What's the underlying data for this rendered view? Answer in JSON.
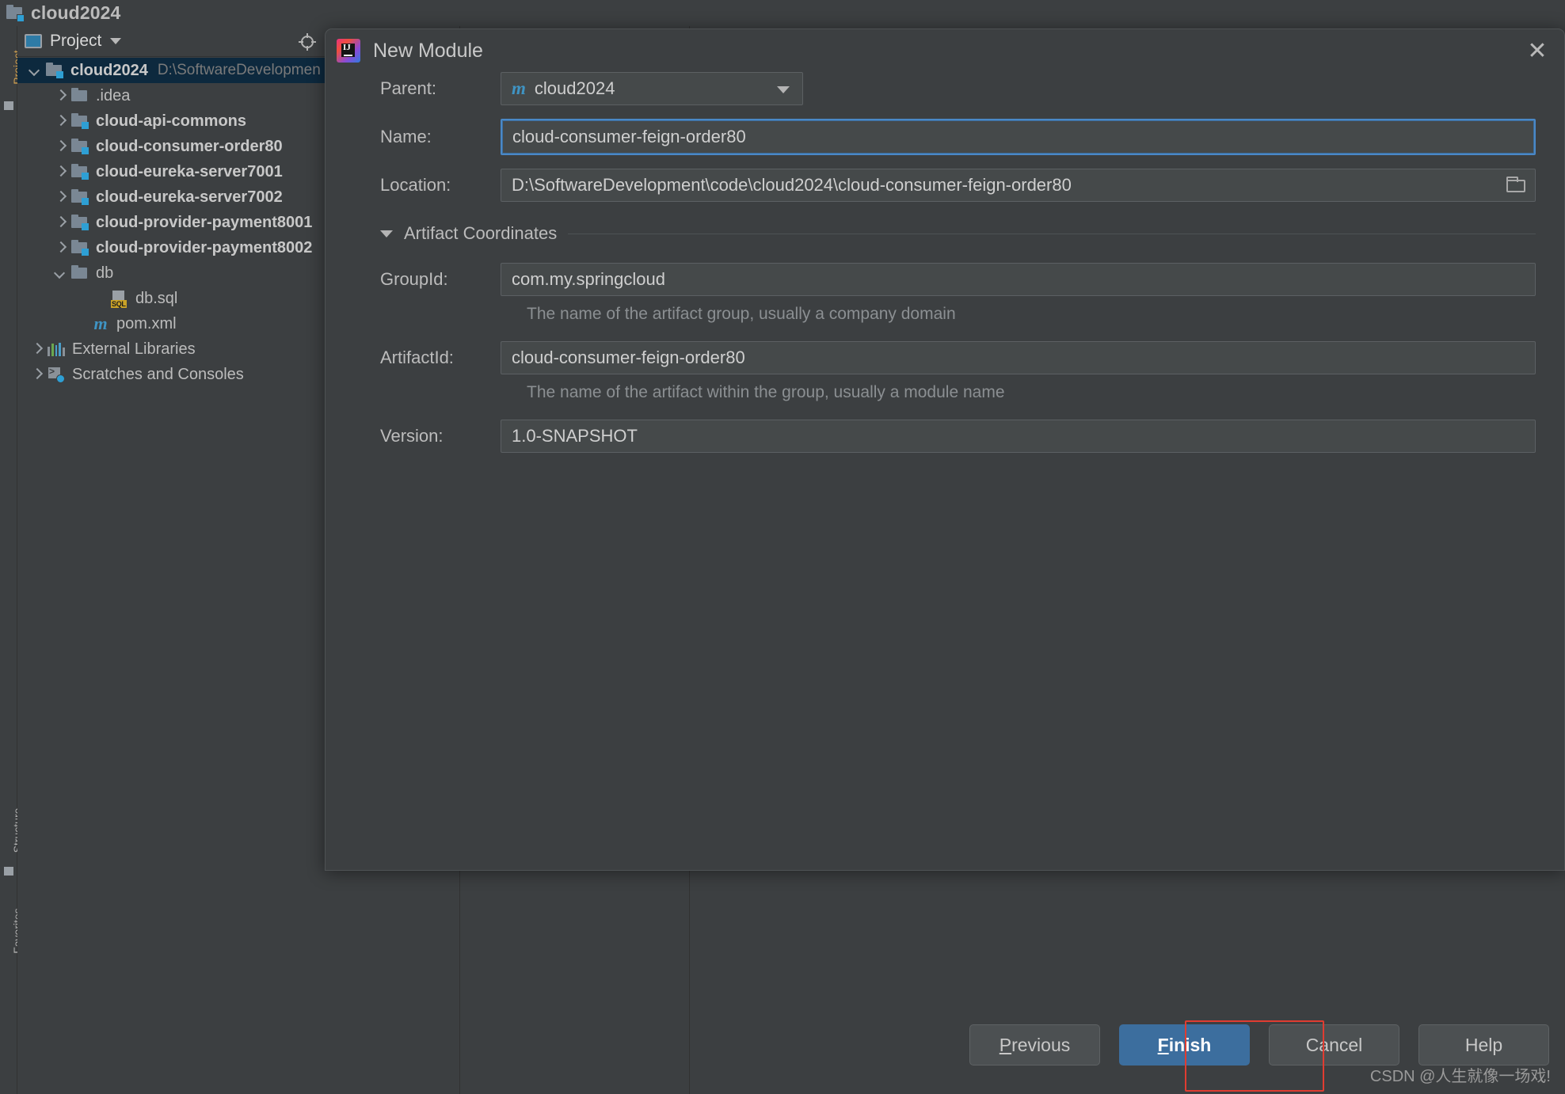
{
  "ide": {
    "title": "cloud2024",
    "strip_labels": [
      "Project",
      "Structure",
      "Favorites"
    ],
    "tool_window": {
      "title": "Project",
      "select_target_icon": "crosshair-icon",
      "dropdown_icon": "chevron-down-icon"
    }
  },
  "tree": [
    {
      "label": "cloud2024",
      "sub": "D:\\SoftwareDevelopmen",
      "icon": "module-folder-icon",
      "arrow": "down",
      "indent": 14,
      "bold": true,
      "selected": true
    },
    {
      "label": ".idea",
      "sub": "",
      "icon": "folder-icon",
      "arrow": "right",
      "indent": 46,
      "bold": false,
      "selected": false
    },
    {
      "label": "cloud-api-commons",
      "sub": "",
      "icon": "module-folder-icon",
      "arrow": "right",
      "indent": 46,
      "bold": true,
      "selected": false
    },
    {
      "label": "cloud-consumer-order80",
      "sub": "",
      "icon": "module-folder-icon",
      "arrow": "right",
      "indent": 46,
      "bold": true,
      "selected": false
    },
    {
      "label": "cloud-eureka-server7001",
      "sub": "",
      "icon": "module-folder-icon",
      "arrow": "right",
      "indent": 46,
      "bold": true,
      "selected": false
    },
    {
      "label": "cloud-eureka-server7002",
      "sub": "",
      "icon": "module-folder-icon",
      "arrow": "right",
      "indent": 46,
      "bold": true,
      "selected": false
    },
    {
      "label": "cloud-provider-payment8001",
      "sub": "",
      "icon": "module-folder-icon",
      "arrow": "right",
      "indent": 46,
      "bold": true,
      "selected": false
    },
    {
      "label": "cloud-provider-payment8002",
      "sub": "",
      "icon": "module-folder-icon",
      "arrow": "right",
      "indent": 46,
      "bold": true,
      "selected": false
    },
    {
      "label": "db",
      "sub": "",
      "icon": "folder-icon",
      "arrow": "down",
      "indent": 46,
      "bold": false,
      "selected": false
    },
    {
      "label": "db.sql",
      "sub": "",
      "icon": "sql-file-icon",
      "arrow": "none",
      "indent": 96,
      "bold": false,
      "selected": false
    },
    {
      "label": "pom.xml",
      "sub": "",
      "icon": "maven-file-icon",
      "arrow": "none",
      "indent": 72,
      "bold": false,
      "selected": false
    },
    {
      "label": "External Libraries",
      "sub": "",
      "icon": "libraries-icon",
      "arrow": "right",
      "indent": 16,
      "bold": false,
      "selected": false
    },
    {
      "label": "Scratches and Consoles",
      "sub": "",
      "icon": "scratches-icon",
      "arrow": "right",
      "indent": 16,
      "bold": false,
      "selected": false
    }
  ],
  "dialog": {
    "title": "New Module",
    "logo_icon": "intellij-idea-icon",
    "close_icon": "close-icon",
    "fields": {
      "parent_label": "Parent:",
      "parent_value": "cloud2024",
      "parent_icon": "maven-module-icon",
      "parent_dropdown_icon": "chevron-down-icon",
      "name_label": "Name:",
      "name_value": "cloud-consumer-feign-order80",
      "location_label": "Location:",
      "location_value": "D:\\SoftwareDevelopment\\code\\cloud2024\\cloud-consumer-feign-order80",
      "location_browse_icon": "folder-browse-icon"
    },
    "artifact_section": {
      "title": "Artifact Coordinates",
      "collapse_icon": "triangle-down-icon",
      "groupid_label": "GroupId:",
      "groupid_value": "com.my.springcloud",
      "groupid_hint": "The name of the artifact group, usually a company domain",
      "artifactid_label": "ArtifactId:",
      "artifactid_value": "cloud-consumer-feign-order80",
      "artifactid_hint": "The name of the artifact within the group, usually a module name",
      "version_label": "Version:",
      "version_value": "1.0-SNAPSHOT"
    },
    "buttons": {
      "previous": "Previous",
      "previous_mnemonic": "P",
      "finish": "Finish",
      "finish_mnemonic": "F",
      "cancel": "Cancel",
      "help": "Help"
    }
  },
  "watermark": "CSDN @人生就像一场戏!",
  "colors": {
    "accent_blue": "#3c6e9e",
    "highlight_red": "#e03c31",
    "panel_bg": "#3c3f41",
    "input_bg": "#45494a",
    "selection_bg": "#0d293e"
  }
}
